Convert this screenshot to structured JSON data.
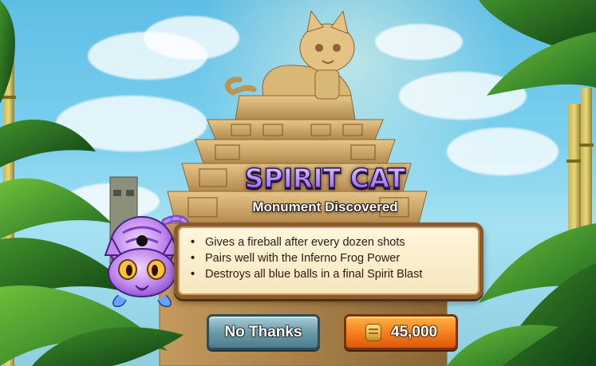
{
  "dialog": {
    "title": "SPIRIT CAT",
    "subtitle": "Monument Discovered",
    "perks": [
      "Gives a fireball after every dozen shots",
      "Pairs well with the Inferno Frog Power",
      "Destroys all blue balls in a final Spirit Blast"
    ],
    "bullet_glyph": "•"
  },
  "buttons": {
    "decline_label": "No Thanks",
    "buy_price": "45,000"
  },
  "icons": {
    "price": "gold-coin-icon",
    "character": "spirit-cat-icon"
  },
  "colors": {
    "title_fill": "#b58cff",
    "decline_button": "#6d9ba8",
    "buy_button": "#f57d1a",
    "panel_bg": "#f6e6bd",
    "panel_border": "#8a5a2a"
  }
}
